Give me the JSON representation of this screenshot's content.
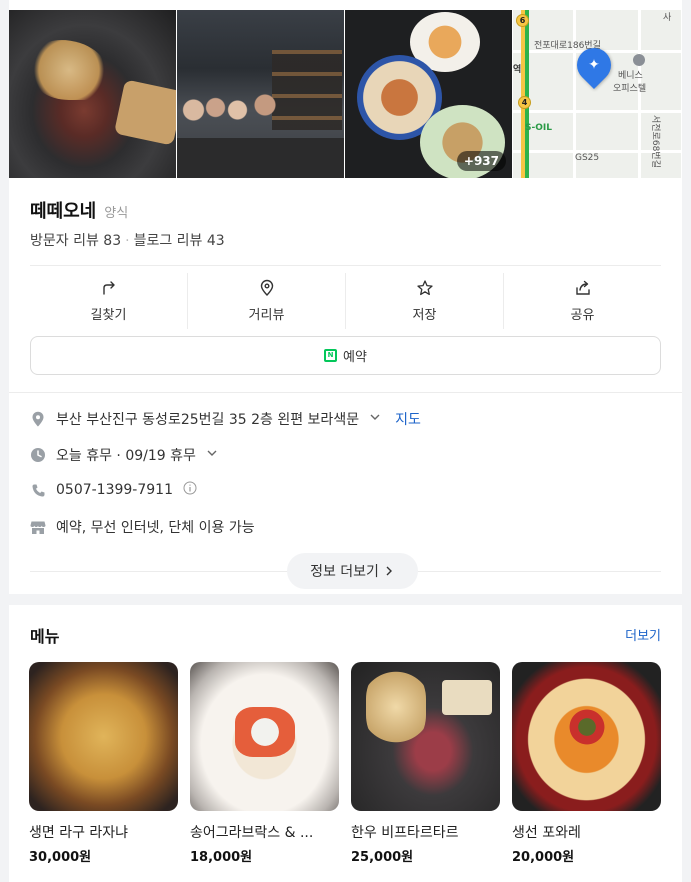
{
  "photos": {
    "more_count": "+937",
    "map": {
      "street_label": "전포대로186번길",
      "poi_label_1": "베니스",
      "poi_label_2": "오피스텔",
      "gas_label": "GS25",
      "oil_label": "S-OIL",
      "road_6": "6",
      "road_4": "4",
      "corner_label": "사",
      "station_char": "역",
      "side_label": "서전로68번길"
    }
  },
  "place": {
    "name": "떼떼오네",
    "category": "양식",
    "visitor_reviews": "방문자 리뷰 83",
    "blog_reviews": "블로그 리뷰 43"
  },
  "actions": [
    {
      "label": "길찾기",
      "icon": "directions-icon"
    },
    {
      "label": "거리뷰",
      "icon": "location-pin-icon"
    },
    {
      "label": "저장",
      "icon": "star-icon"
    },
    {
      "label": "공유",
      "icon": "share-icon"
    }
  ],
  "reserve": {
    "label": "예약",
    "badge": "N"
  },
  "info": {
    "address": "부산 부산진구 동성로25번길 35 2층 왼편 보라색문",
    "map_link": "지도",
    "hours": "오늘 휴무 · 09/19 휴무",
    "phone": "0507-1399-7911",
    "amenities": "예약, 무선 인터넷, 단체 이용 가능"
  },
  "more_info_label": "정보 더보기",
  "menu": {
    "title": "메뉴",
    "more_label": "더보기",
    "items": [
      {
        "name": "생면 라구 라자냐",
        "price": "30,000원"
      },
      {
        "name": "송어그라브락스 & ...",
        "price": "18,000원"
      },
      {
        "name": "한우 비프타르타르",
        "price": "25,000원"
      },
      {
        "name": "생선 포와레",
        "price": "20,000원"
      }
    ]
  },
  "colors": {
    "link": "#1c63c9",
    "map_pin": "#2f78e6",
    "naver_green": "#03c75a"
  }
}
